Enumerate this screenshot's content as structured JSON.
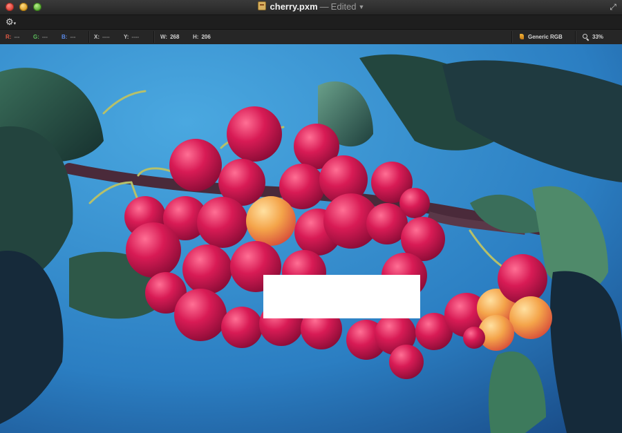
{
  "window": {
    "filename": "cherry.pxm",
    "separator": "—",
    "status": "Edited"
  },
  "icons": {
    "traffic_lights": [
      "close-icon",
      "minimize-icon",
      "zoom-icon"
    ],
    "document": "document-icon",
    "fullscreen": "fullscreen-icon",
    "settings": "gear-icon",
    "color_profile": "color-profile-icon",
    "zoom": "magnifier-icon"
  },
  "infobar": {
    "r_label": "R:",
    "r_value": "---",
    "g_label": "G:",
    "g_value": "---",
    "b_label": "B:",
    "b_value": "---",
    "x_label": "X:",
    "x_value": "----",
    "y_label": "Y:",
    "y_value": "----",
    "w_label": "W:",
    "w_value": "268",
    "h_label": "H:",
    "h_value": "206",
    "color_profile": "Generic RGB",
    "zoom": "33%"
  },
  "colors": {
    "sky": "#2f86c8",
    "cherry": "#d11a4f",
    "cherry_light": "#f0a444",
    "leaf": "#2f5a46"
  }
}
